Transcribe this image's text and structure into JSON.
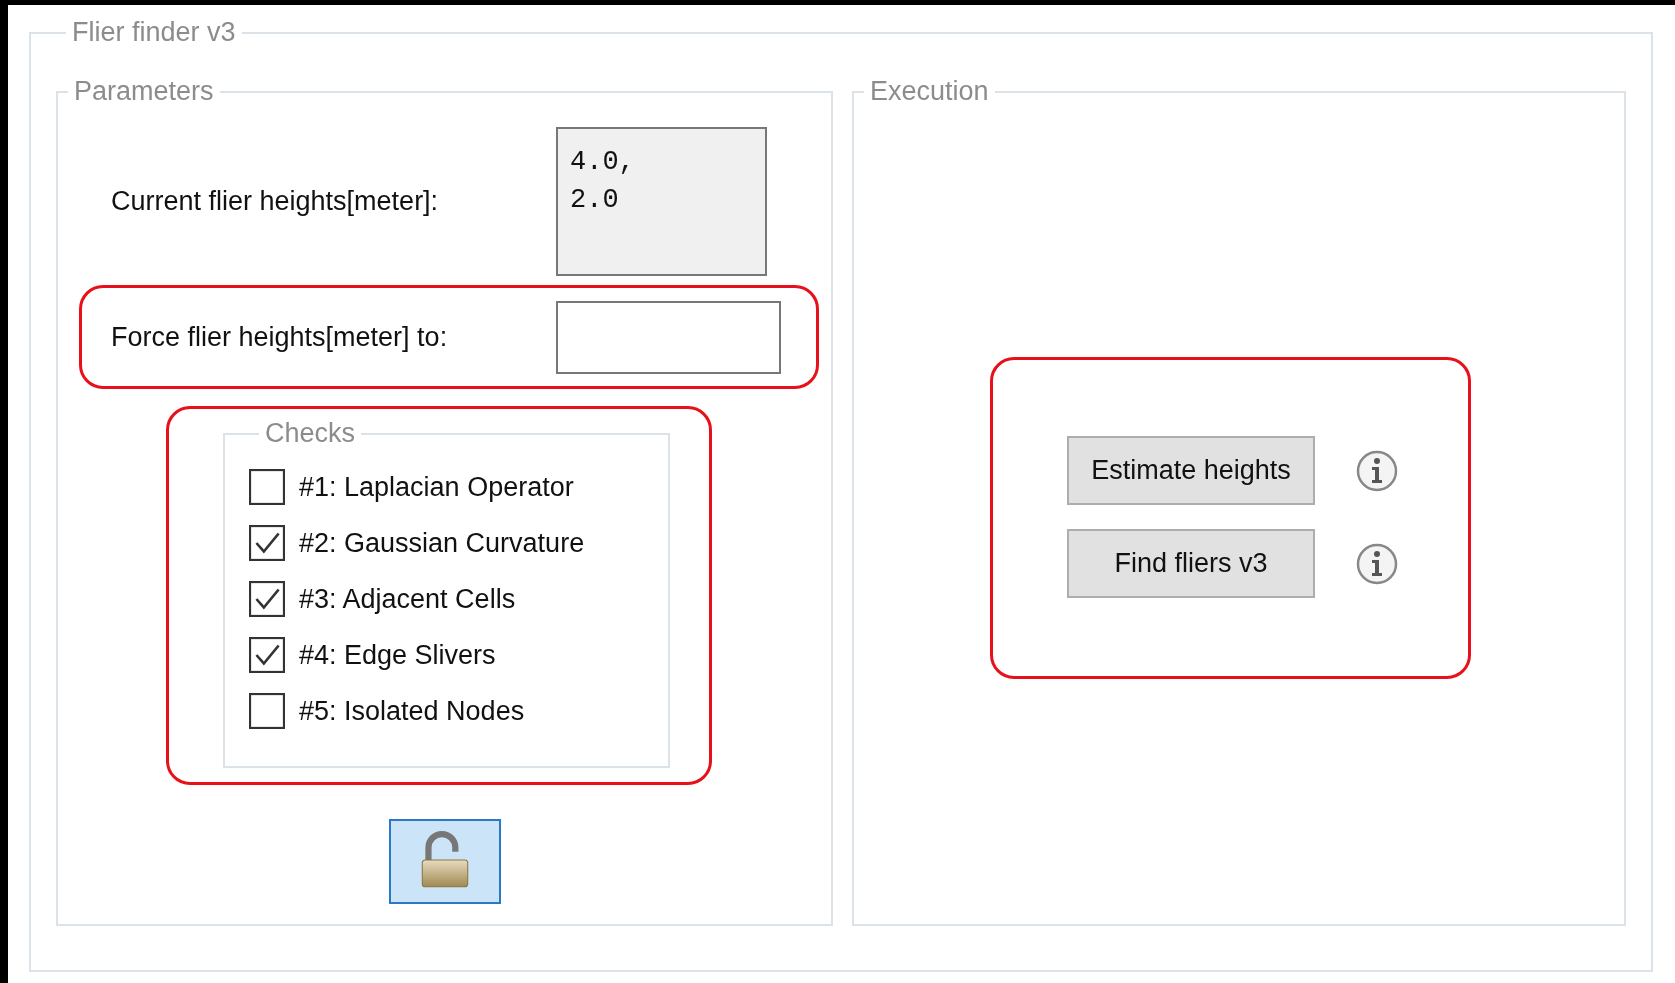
{
  "window": {
    "title": "Flier finder v3"
  },
  "parameters": {
    "title": "Parameters",
    "current_heights": {
      "label": "Current flier heights[meter]:",
      "value_lines": [
        "4.0,",
        "2.0"
      ]
    },
    "force_heights": {
      "label": "Force flier heights[meter] to:"
    },
    "checks": {
      "title": "Checks",
      "items": [
        {
          "label": "#1: Laplacian Operator",
          "checked": false
        },
        {
          "label": "#2: Gaussian Curvature",
          "checked": true
        },
        {
          "label": "#3: Adjacent Cells",
          "checked": true
        },
        {
          "label": "#4: Edge Slivers",
          "checked": true
        },
        {
          "label": "#5: Isolated Nodes",
          "checked": false
        }
      ]
    },
    "lock": {
      "locked": false
    }
  },
  "execution": {
    "title": "Execution",
    "buttons": [
      {
        "label": "Estimate heights"
      },
      {
        "label": "Find fliers v3"
      }
    ]
  }
}
